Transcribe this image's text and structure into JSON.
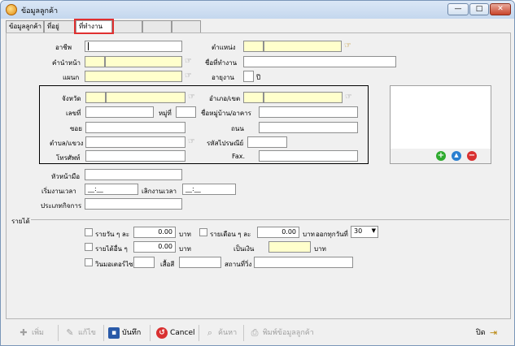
{
  "window": {
    "title": "ข้อมูลลูกค้า",
    "min": "—",
    "max": "□",
    "close": "✕"
  },
  "tabs": [
    {
      "label": "ข้อมูลลูกค้า"
    },
    {
      "label": "ที่อยู่"
    },
    {
      "label": "ที่ทำงาน"
    },
    {
      "label": ""
    },
    {
      "label": ""
    },
    {
      "label": ""
    }
  ],
  "form": {
    "occupation_label": "อาชีพ",
    "position_label": "ตำแหน่ง",
    "prefix_label": "คำนำหน้า",
    "workplace_name_label": "ชื่อที่ทำงาน",
    "department_label": "แผนก",
    "years_worked_label": "อายุงาน",
    "years_unit": "ปี",
    "province_label": "จังหวัด",
    "district_label": "อำเภอ/เขต",
    "number_label": "เลขที่",
    "moo_label": "หมู่ที่",
    "village_label": "ชื่อหมู่บ้าน/อาคาร",
    "soi_label": "ซอย",
    "road_label": "ถนน",
    "subdistrict_label": "ตำบล/แขวง",
    "postcode_label": "รหัสไปรษณีย์",
    "phone_label": "โทรศัพท์",
    "fax_label": "Fax.",
    "supervisor_label": "หัวหน้ามือ",
    "start_time_label": "เริ่มงานเวลา",
    "start_time_value": "__:__",
    "end_time_label": "เลิกงานเวลา",
    "end_time_value": "__:__",
    "business_type_label": "ประเภทกิจการ"
  },
  "income": {
    "section_label": "รายได้",
    "daily_label": "รายวัน ๆ ละ",
    "daily_value": "0.00",
    "monthly_label": "รายเดือน ๆ ละ",
    "monthly_value": "0.00",
    "payday_label": "ออกทุกวันที่",
    "payday_value": "30",
    "commission_label": "รายได้อื่น ๆ",
    "commission_value": "0.00",
    "in_cash_label": "เป็นเงิน",
    "currency": "บาท",
    "motorbike_label": "วินมอเตอร์ไซค์",
    "vest_label": "เสื้อสี",
    "station_label": "สถานที่วิ่ง"
  },
  "image_panel": {
    "add": "+",
    "up": "▲",
    "remove": "−"
  },
  "toolbar": {
    "add": "เพิ่ม",
    "edit": "แก้ไข",
    "save": "บันทึก",
    "cancel": "Cancel",
    "search": "ค้นหา",
    "print": "พิมพ์ข้อมูลลูกค้า",
    "close": "ปิด"
  },
  "colors": {
    "required_field": "#ffffcc",
    "active_tab_outline": "#e03030",
    "add_green": "#2eaa2e",
    "up_blue": "#2a7fd0",
    "remove_red": "#d93030"
  }
}
